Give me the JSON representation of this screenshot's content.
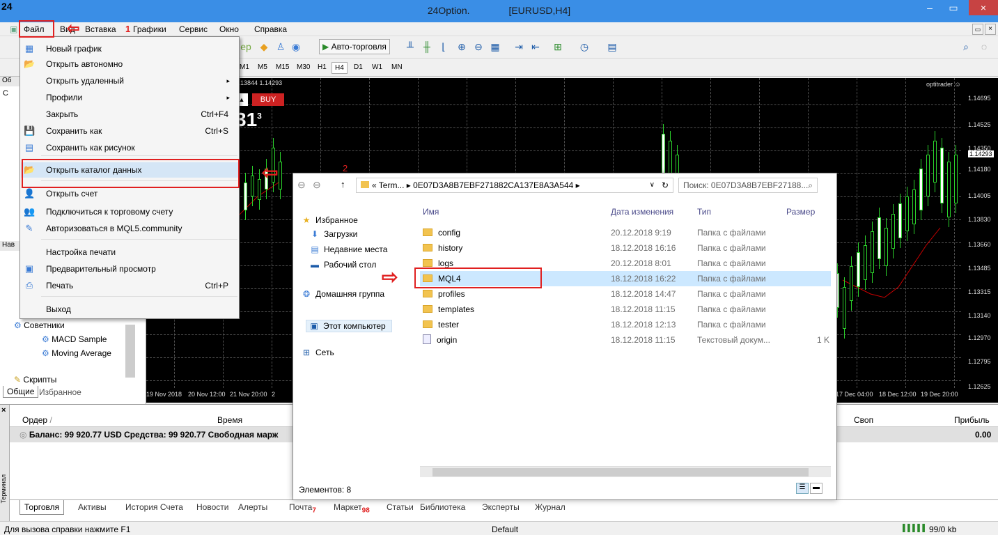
{
  "window": {
    "app_icon": "24",
    "title_app": "24Option.",
    "title_symbol": "[EURUSD,H4]",
    "close_symbol": "×",
    "minimize_symbol": "–",
    "maximize_symbol": "▭"
  },
  "menu": [
    "Файл",
    "Вид",
    "Вставка",
    "Графики",
    "Сервис",
    "Окно",
    "Справка"
  ],
  "toolbar": {
    "autotrade_label": "Авто-торговля",
    "timeframes": [
      "M1",
      "M5",
      "M15",
      "M30",
      "H1",
      "H4",
      "D1",
      "W1",
      "MN"
    ],
    "active_timeframe": "H4"
  },
  "chart": {
    "symbol_info": "341 1.13844 1.14293",
    "buy_label": "BUY",
    "price_prefix": "4",
    "price_big": "31",
    "price_sup": "3",
    "watermark": "optitrader ☺",
    "price_labels": [
      "1.14695",
      "1.14525",
      "1.14350",
      "1.14293",
      "1.14180",
      "1.14005",
      "1.13830",
      "1.13660",
      "1.13485",
      "1.13315",
      "1.13140",
      "1.12970",
      "1.12795",
      "1.12625"
    ],
    "time_labels": [
      "19 Nov 2018",
      "20 Nov 12:00",
      "21 Nov 20:00",
      "2",
      "17 Dec 04:00",
      "18 Dec 12:00",
      "19 Dec 20:00"
    ]
  },
  "left_panel": {
    "header_abbrev": "Об",
    "row_abbrev": "С",
    "nav_abbrev": "Нав",
    "tree": [
      "Советники",
      "MACD Sample",
      "Moving Average",
      "Скрипты"
    ],
    "tabs": [
      "Общие",
      "Избранное"
    ]
  },
  "file_menu": {
    "items": [
      {
        "label": "Новый график",
        "icon": "new-chart-icon",
        "glyph": "▦",
        "shortcut": "",
        "submenu": false
      },
      {
        "label": "Открыть автономно",
        "icon": "open-folder-icon",
        "glyph": "📂",
        "shortcut": "",
        "submenu": false
      },
      {
        "label": "Открыть удаленный",
        "icon": "",
        "glyph": "",
        "shortcut": "",
        "submenu": true
      },
      {
        "label": "Профили",
        "icon": "",
        "glyph": "",
        "shortcut": "",
        "submenu": true
      },
      {
        "label": "Закрыть",
        "icon": "",
        "glyph": "",
        "shortcut": "Ctrl+F4",
        "submenu": false
      },
      {
        "label": "Сохранить как",
        "icon": "save-icon",
        "glyph": "💾",
        "shortcut": "Ctrl+S",
        "submenu": false
      },
      {
        "label": "Сохранить как рисунок",
        "icon": "save-picture-icon",
        "glyph": "▤",
        "shortcut": "",
        "submenu": false
      },
      {
        "label": "Открыть каталог данных",
        "icon": "data-folder-icon",
        "glyph": "📂",
        "shortcut": "",
        "submenu": false
      },
      {
        "label": "Открыть счет",
        "icon": "open-account-icon",
        "glyph": "👤",
        "shortcut": "",
        "submenu": false
      },
      {
        "label": "Подключиться к торговому счету",
        "icon": "connect-account-icon",
        "glyph": "👥",
        "shortcut": "",
        "submenu": false
      },
      {
        "label": "Авторизоваться в MQL5.community",
        "icon": "mql5-icon",
        "glyph": "✎",
        "shortcut": "",
        "submenu": false
      },
      {
        "label": "Настройка печати",
        "icon": "",
        "glyph": "",
        "shortcut": "",
        "submenu": false
      },
      {
        "label": "Предварительный просмотр",
        "icon": "print-preview-icon",
        "glyph": "▣",
        "shortcut": "",
        "submenu": false
      },
      {
        "label": "Печать",
        "icon": "print-icon",
        "glyph": "⎙",
        "shortcut": "Ctrl+P",
        "submenu": false
      },
      {
        "label": "Выход",
        "icon": "",
        "glyph": "",
        "shortcut": "",
        "submenu": false
      }
    ]
  },
  "annotations": {
    "step1": "1",
    "step2": "2"
  },
  "explorer": {
    "address": "« Term... ▸ 0E07D3A8B7EBF271882CA137E8A3A544 ▸",
    "search_placeholder": "Поиск: 0E07D3A8B7EBF27188...",
    "nav": [
      "Избранное",
      "Загрузки",
      "Недавние места",
      "Рабочий стол",
      "Домашняя группа",
      "Этот компьютер",
      "Сеть"
    ],
    "columns": [
      "Имя",
      "Дата изменения",
      "Тип",
      "Размер"
    ],
    "files": [
      {
        "name": "config",
        "date": "20.12.2018 9:19",
        "type": "Папка с файлами",
        "size": ""
      },
      {
        "name": "history",
        "date": "18.12.2018 16:16",
        "type": "Папка с файлами",
        "size": ""
      },
      {
        "name": "logs",
        "date": "20.12.2018 8:01",
        "type": "Папка с файлами",
        "size": ""
      },
      {
        "name": "MQL4",
        "date": "18.12.2018 16:22",
        "type": "Папка с файлами",
        "size": ""
      },
      {
        "name": "profiles",
        "date": "18.12.2018 14:47",
        "type": "Папка с файлами",
        "size": ""
      },
      {
        "name": "templates",
        "date": "18.12.2018 11:15",
        "type": "Папка с файлами",
        "size": ""
      },
      {
        "name": "tester",
        "date": "18.12.2018 12:13",
        "type": "Папка с файлами",
        "size": ""
      },
      {
        "name": "origin",
        "date": "18.12.2018 11:15",
        "type": "Текстовый докум...",
        "size": "1 K"
      }
    ],
    "status": "Элементов: 8"
  },
  "terminal": {
    "side_label": "Терминал",
    "col_order": "Ордер",
    "col_time": "Время",
    "col_swap": "Своп",
    "col_profit": "Прибыль",
    "balance": "Баланс: 99 920.77 USD  Средства: 99 920.77  Свободная марж",
    "balance_profit": "0.00",
    "tabs": [
      "Торговля",
      "Активы",
      "История Счета",
      "Новости",
      "Алерты",
      "Почта",
      "Маркет",
      "Статьи",
      "Библиотека",
      "Эксперты",
      "Журнал"
    ],
    "mail_badge": "7",
    "market_badge": "98"
  },
  "statusbar": {
    "help": "Для вызова справки нажмите F1",
    "profile": "Default",
    "traffic": "99/0 kb"
  }
}
